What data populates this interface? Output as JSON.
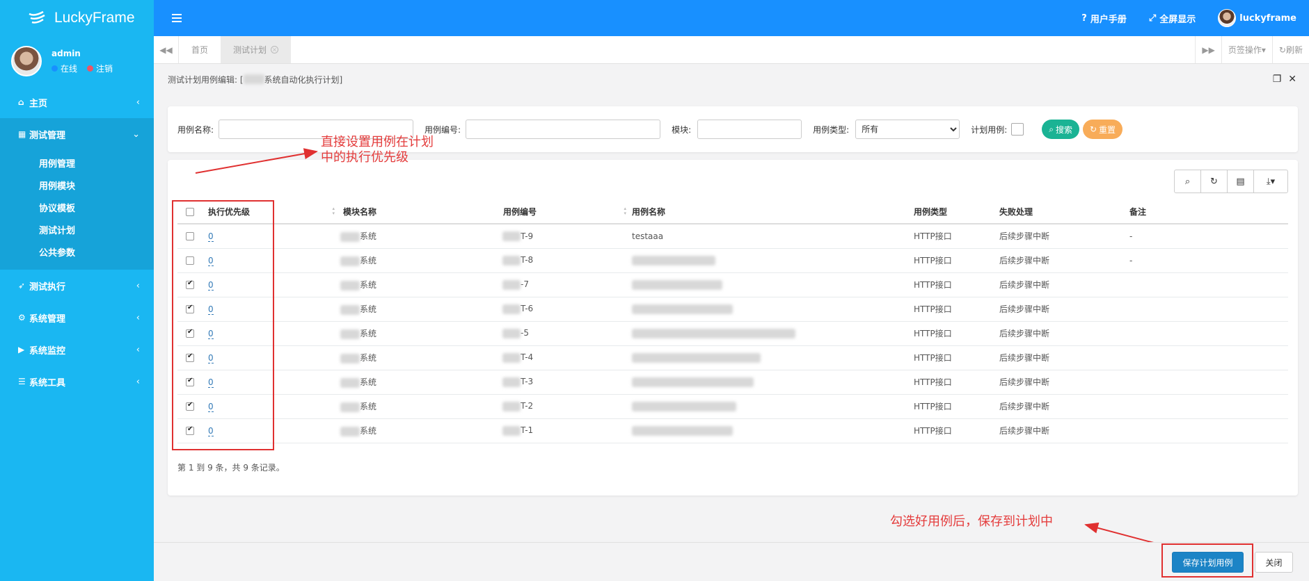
{
  "app": {
    "name": "LuckyFrame"
  },
  "user": {
    "name": "admin",
    "online": "在线",
    "logout": "注销"
  },
  "sidebar": {
    "items": [
      {
        "label": "主页",
        "icon": "home-icon"
      },
      {
        "label": "测试管理",
        "icon": "grid-icon",
        "children": [
          "用例管理",
          "用例模块",
          "协议模板",
          "测试计划",
          "公共参数"
        ]
      },
      {
        "label": "测试执行",
        "icon": "rocket-icon"
      },
      {
        "label": "系统管理",
        "icon": "gear-icon"
      },
      {
        "label": "系统监控",
        "icon": "video-icon"
      },
      {
        "label": "系统工具",
        "icon": "bars-icon"
      }
    ]
  },
  "topbar": {
    "manual": "用户手册",
    "fullscreen": "全屏显示",
    "account": "luckyframe"
  },
  "tabs": {
    "home": "首页",
    "active": "测试计划",
    "ops": "页签操作",
    "refresh": "刷新"
  },
  "page": {
    "title_prefix": "测试计划用例编辑: [",
    "title_suffix": "系统自动化执行计划]"
  },
  "search": {
    "case_name_label": "用例名称:",
    "case_no_label": "用例编号:",
    "module_label": "模块:",
    "case_type_label": "用例类型:",
    "case_type_value": "所有",
    "plan_case_label": "计划用例:",
    "search_btn": "搜索",
    "reset_btn": "重置"
  },
  "table": {
    "columns": [
      "执行优先级",
      "模块名称",
      "用例编号",
      "用例名称",
      "用例类型",
      "失败处理",
      "备注"
    ],
    "rows": [
      {
        "checked": false,
        "priority": "0",
        "module": "系统",
        "case_no": "T-9",
        "case_name": "testaaa",
        "type": "HTTP接口",
        "fail": "后续步骤中断",
        "note": "-"
      },
      {
        "checked": false,
        "priority": "0",
        "module": "系统",
        "case_no": "T-8",
        "case_name": "",
        "type": "HTTP接口",
        "fail": "后续步骤中断",
        "note": "-"
      },
      {
        "checked": true,
        "priority": "0",
        "module": "系统",
        "case_no": "-7",
        "case_name": "",
        "type": "HTTP接口",
        "fail": "后续步骤中断",
        "note": ""
      },
      {
        "checked": true,
        "priority": "0",
        "module": "系统",
        "case_no": "T-6",
        "case_name": "",
        "type": "HTTP接口",
        "fail": "后续步骤中断",
        "note": ""
      },
      {
        "checked": true,
        "priority": "0",
        "module": "系统",
        "case_no": "-5",
        "case_name": "",
        "type": "HTTP接口",
        "fail": "后续步骤中断",
        "note": ""
      },
      {
        "checked": true,
        "priority": "0",
        "module": "系统",
        "case_no": "T-4",
        "case_name": "",
        "type": "HTTP接口",
        "fail": "后续步骤中断",
        "note": ""
      },
      {
        "checked": true,
        "priority": "0",
        "module": "系统",
        "case_no": "T-3",
        "case_name": "",
        "type": "HTTP接口",
        "fail": "后续步骤中断",
        "note": ""
      },
      {
        "checked": true,
        "priority": "0",
        "module": "系统",
        "case_no": "T-2",
        "case_name": "",
        "type": "HTTP接口",
        "fail": "后续步骤中断",
        "note": ""
      },
      {
        "checked": true,
        "priority": "0",
        "module": "系统",
        "case_no": "T-1",
        "case_name": "",
        "type": "HTTP接口",
        "fail": "后续步骤中断",
        "note": ""
      }
    ],
    "pager_info": "第 1 到 9 条，共 9 条记录。"
  },
  "annotations": {
    "top": [
      "直接设置用例在计划",
      "中的执行优先级"
    ],
    "bottom": "勾选好用例后，保存到计划中"
  },
  "footer": {
    "save": "保存计划用例",
    "close": "关闭"
  },
  "colors": {
    "sidebar": "#1ab7f2",
    "topbar": "#1890ff",
    "search_btn": "#1ab394",
    "reset_btn": "#f8ac59",
    "primary": "#1c84c6",
    "annotation": "#e03030"
  }
}
